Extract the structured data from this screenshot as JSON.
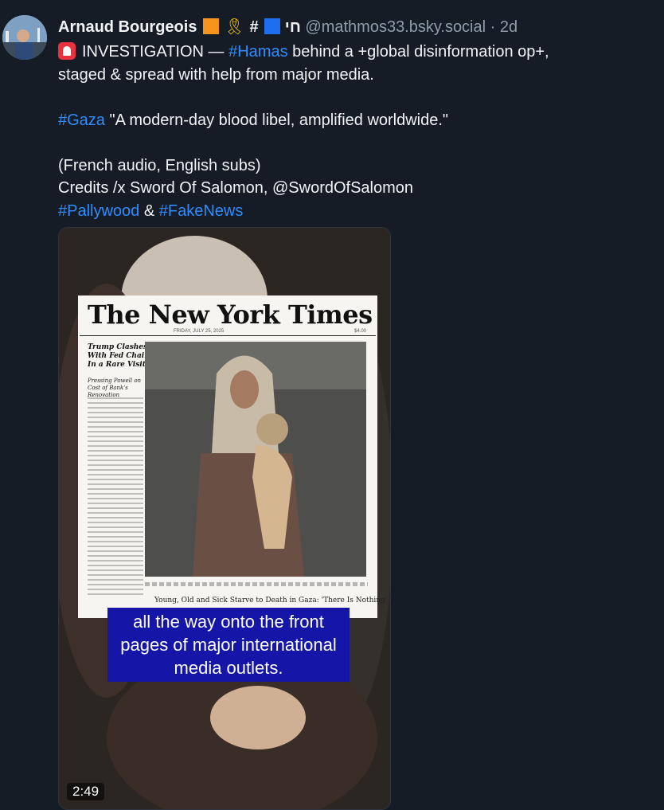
{
  "post": {
    "author_name": "Arnaud Bourgeois",
    "author_suffix": "#",
    "author_hebrew": "חי",
    "handle": "@mathmos33.bsky.social",
    "separator": "·",
    "time_ago": "2d",
    "line1_prefix": "INVESTIGATION —",
    "hashtag_hamas": "#Hamas",
    "line1_suffix": "behind a +global disinformation op+,",
    "line2": "staged & spread with help from major media.",
    "hashtag_gaza": "#Gaza",
    "line3_suffix": "\"A modern-day blood libel, amplified worldwide.\"",
    "line4": "(French audio, English subs)",
    "line5": "Credits /x Sword Of Salomon, @SwordOfSalomon",
    "hashtag_pallywood": "#Pallywood",
    "ampersand": "&",
    "hashtag_fakenews": "#FakeNews"
  },
  "video": {
    "duration": "2:49",
    "subtitle_line1": "all the way onto the front",
    "subtitle_line2": "pages of major international",
    "subtitle_line3": "media outlets.",
    "newspaper_masthead": "The New York Times",
    "newspaper_date": "FRIDAY, JULY 25, 2025",
    "newspaper_price": "$4.00",
    "newspaper_headline": "Trump Clashes With Fed Chair In a Rare Visit",
    "newspaper_subhead": "Pressing Powell on Cost of Bank's Renovation",
    "newspaper_photo_caption": "Young, Old and Sick Starve to Death in Gaza: 'There Is Nothing'"
  },
  "colors": {
    "background": "#151c26",
    "link": "#2f8cff",
    "handle": "#8f9cab",
    "flag_orange": "#f7941d",
    "flag_blue": "#1e6ff0",
    "subtitle_box": "#1515a8"
  }
}
